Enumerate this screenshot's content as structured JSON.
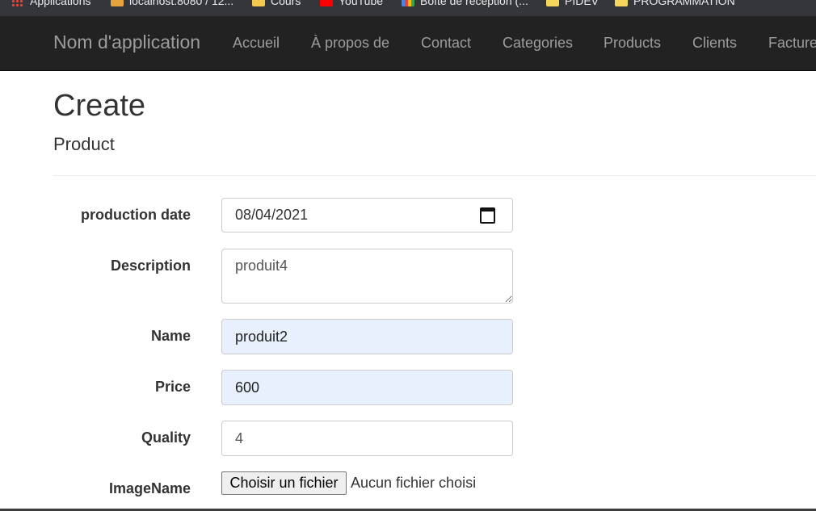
{
  "bookmarks": [
    {
      "label": "Applications",
      "icon": "apps-grid-icon"
    },
    {
      "label": "localhost:8080 / 12...",
      "icon": "phpmyadmin-icon"
    },
    {
      "label": "Cours",
      "icon": "classroom-icon"
    },
    {
      "label": "YouTube",
      "icon": "youtube-icon"
    },
    {
      "label": "Boîte de réception (...",
      "icon": "gmail-icon"
    },
    {
      "label": "PIDEV",
      "icon": "folder-icon"
    },
    {
      "label": "PROGRAMMATION",
      "icon": "folder-icon"
    }
  ],
  "navbar": {
    "brand": "Nom d'application",
    "items": [
      "Accueil",
      "À propos de",
      "Contact",
      "Categories",
      "Products",
      "Clients",
      "Facture"
    ]
  },
  "page": {
    "title": "Create",
    "subtitle": "Product"
  },
  "form": {
    "production_date": {
      "label": "production date",
      "value": "08/04/2021"
    },
    "description": {
      "label": "Description",
      "value": "produit4"
    },
    "name": {
      "label": "Name",
      "value": "produit2"
    },
    "price": {
      "label": "Price",
      "value": "600"
    },
    "quality": {
      "label": "Quality",
      "value": "4"
    },
    "image": {
      "label": "ImageName",
      "button": "Choisir un fichier",
      "status": "Aucun fichier choisi"
    }
  },
  "colors": {
    "navbar_bg": "#222222",
    "navbar_text": "#9d9d9d",
    "autofill_bg": "#e8f0fe"
  }
}
